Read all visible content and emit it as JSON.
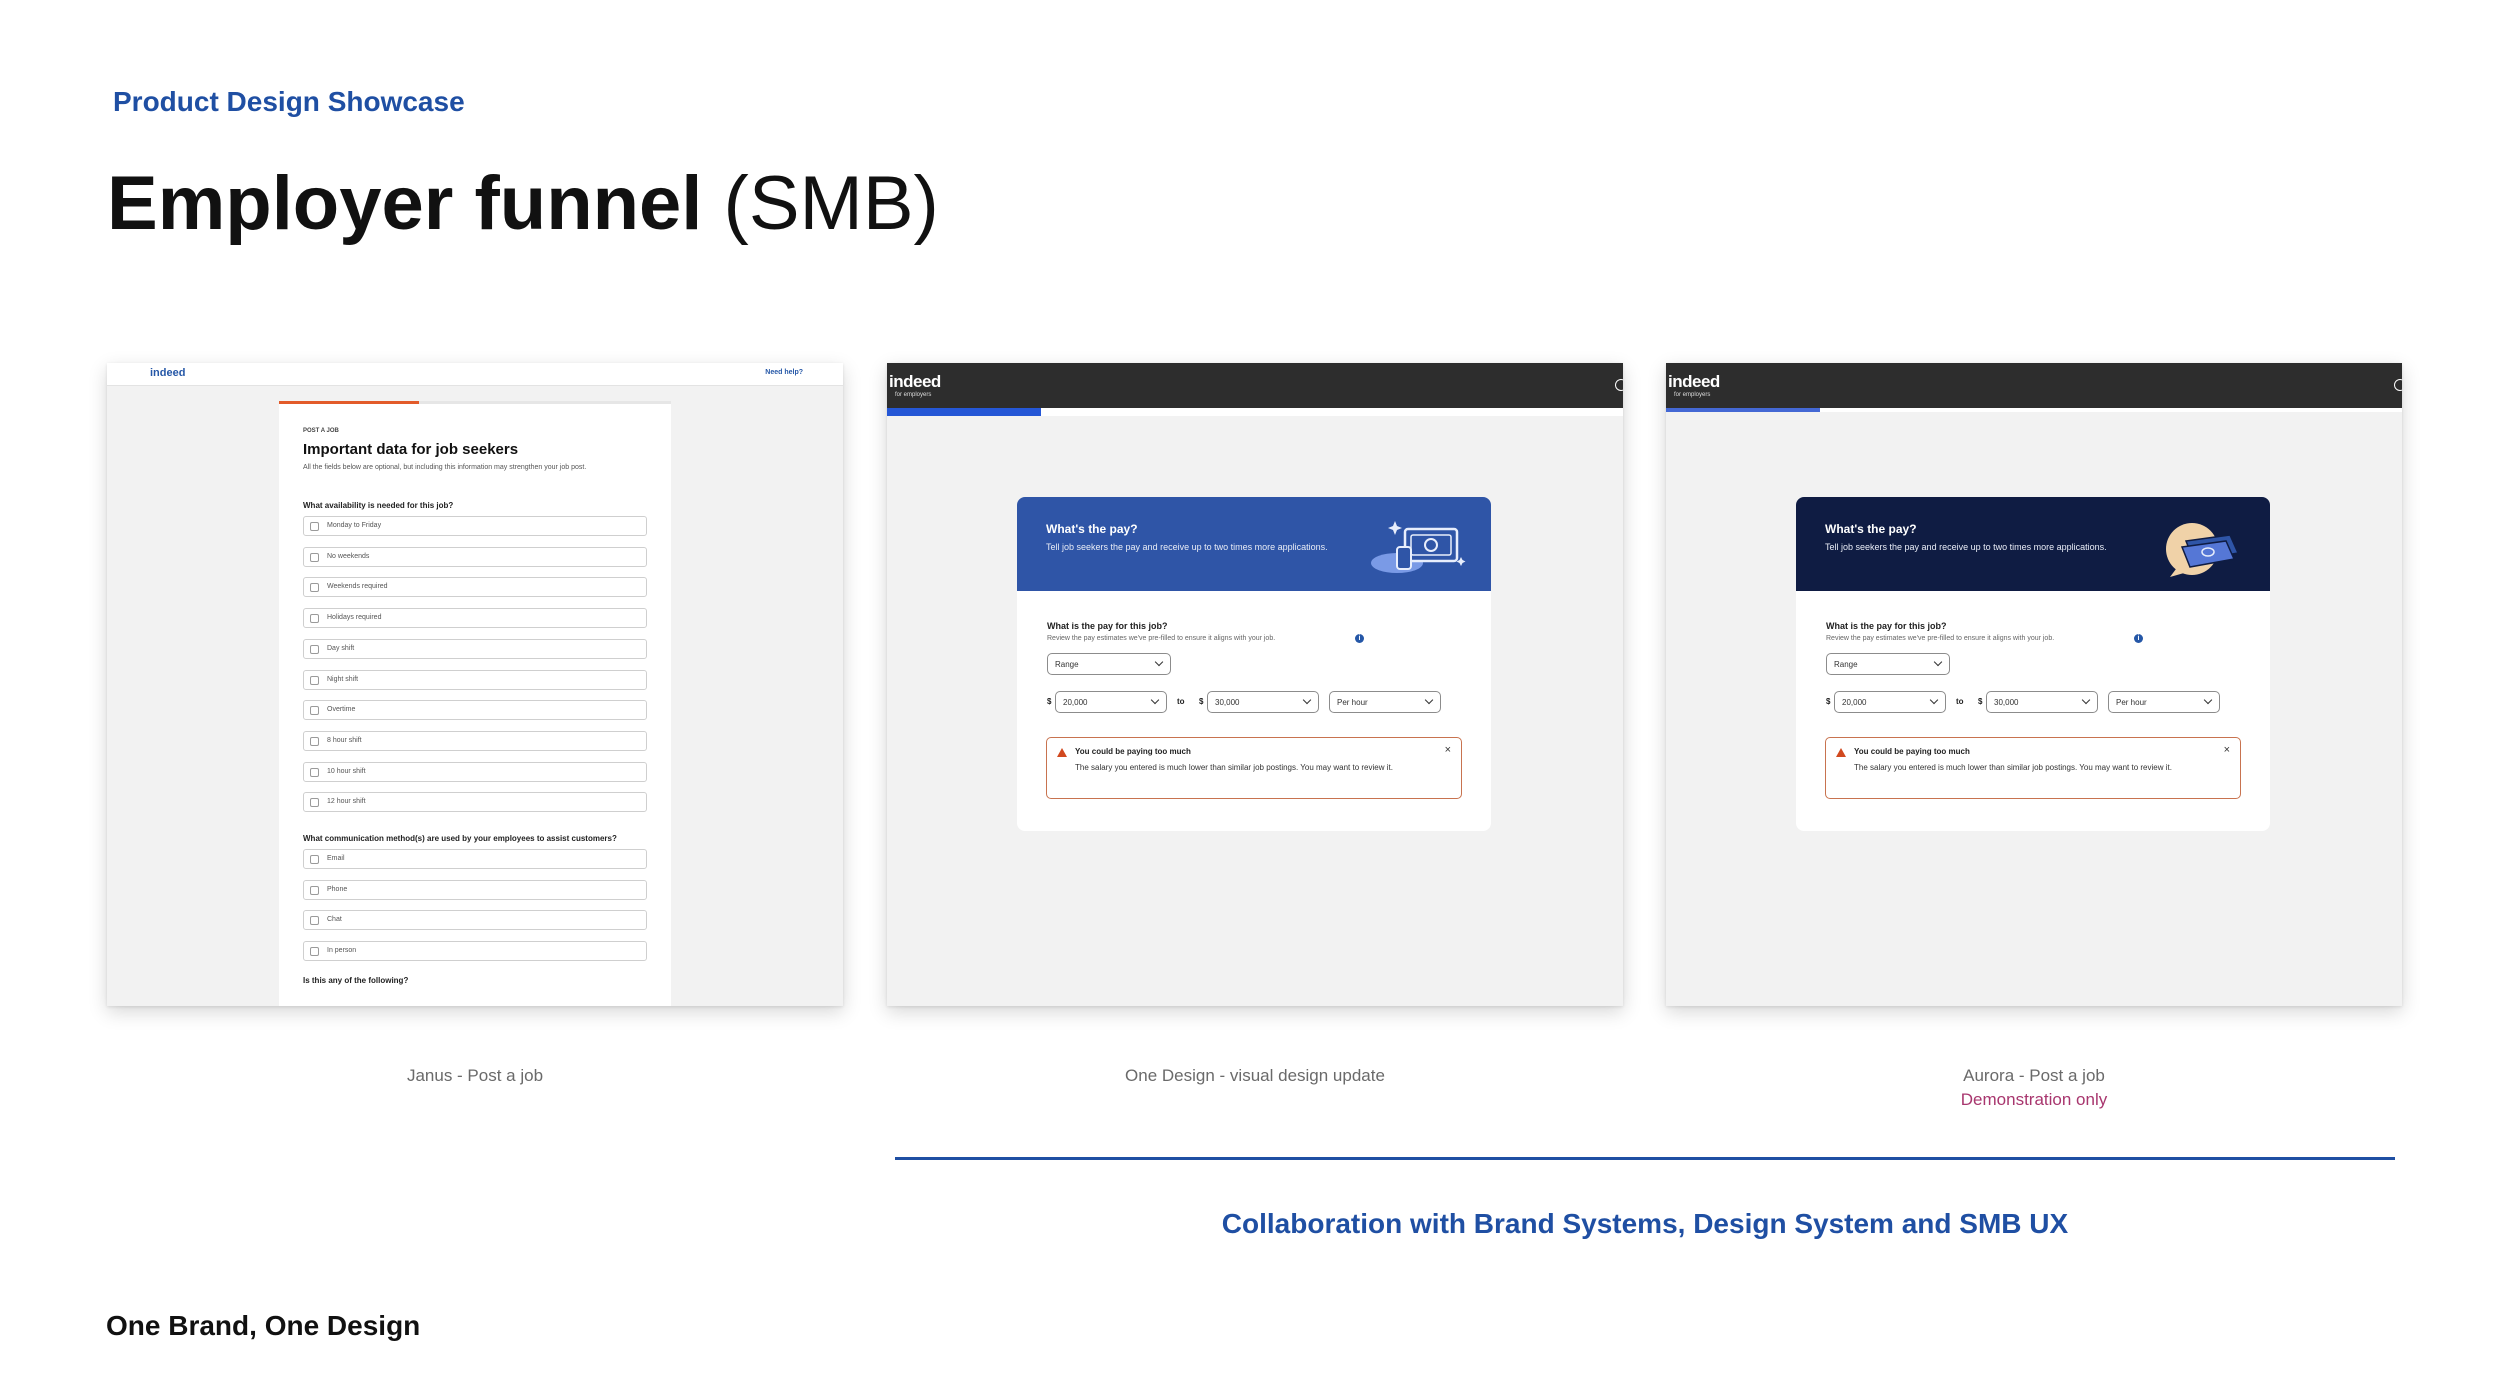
{
  "header": {
    "eyebrow": "Product Design Showcase",
    "title_bold": "Employer funnel",
    "title_regular": "(SMB)"
  },
  "janus": {
    "logo": "indeed",
    "help": "Need help?",
    "step": "POST A JOB",
    "title": "Important data for job seekers",
    "subtitle": "All the fields below are optional, but including this information may strengthen your job post.",
    "q1": "What availability is needed for this job?",
    "availability": [
      "Monday to Friday",
      "No weekends",
      "Weekends required",
      "Holidays required",
      "Day shift",
      "Night shift",
      "Overtime",
      "8 hour shift",
      "10 hour shift",
      "12 hour shift"
    ],
    "q2": "What communication method(s) are used by your employees to assist customers?",
    "communication": [
      "Email",
      "Phone",
      "Chat",
      "In person"
    ],
    "q3": "Is this any of the following?"
  },
  "pay_form": {
    "logo": "indeed",
    "logo_sub": "for employers",
    "header_title": "What's the pay?",
    "header_sub": "Tell job seekers the pay and receive up to two times more applications.",
    "question": "What is the pay for this job?",
    "hint": "Review the pay estimates we've pre-filled to ensure it aligns with your job.",
    "pay_type": "Range",
    "currency": "$",
    "min": "20,000",
    "to": "to",
    "max": "30,000",
    "period": "Per hour",
    "alert_title": "You could be paying too much",
    "alert_body": "The salary you entered is much lower than similar job postings. You may want to review it.",
    "close": "×"
  },
  "captions": {
    "shot1": "Janus - Post a job",
    "shot2": "One Design - visual design update",
    "shot3": "Aurora - Post a job",
    "shot3_note": "Demonstration only"
  },
  "collab": "Collaboration with Brand Systems, Design System and SMB UX",
  "footer": "One Brand, One Design",
  "colors": {
    "accent": "#1f4fa3",
    "one_design_header": "#2f55a7",
    "aurora_header": "#0f1c43",
    "warning": "#d1491f",
    "demo_note": "#a8366e"
  }
}
